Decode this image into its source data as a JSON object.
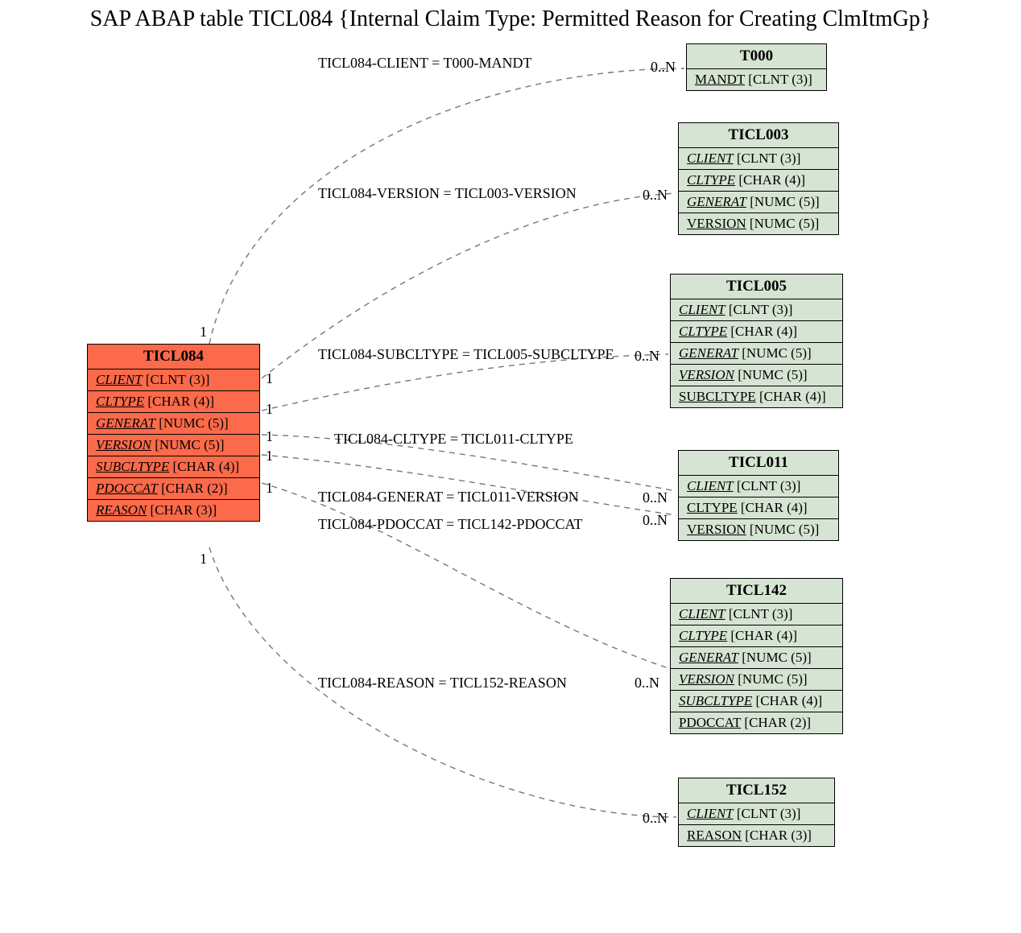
{
  "title": "SAP ABAP table TICL084 {Internal Claim Type: Permitted Reason for Creating ClmItmGp}",
  "mainEntity": {
    "name": "TICL084",
    "fields": [
      {
        "name": "CLIENT",
        "type": "[CLNT (3)]",
        "fk": true
      },
      {
        "name": "CLTYPE",
        "type": "[CHAR (4)]",
        "fk": true
      },
      {
        "name": "GENERAT",
        "type": "[NUMC (5)]",
        "fk": true
      },
      {
        "name": "VERSION",
        "type": "[NUMC (5)]",
        "fk": true
      },
      {
        "name": "SUBCLTYPE",
        "type": "[CHAR (4)]",
        "fk": true
      },
      {
        "name": "PDOCCAT",
        "type": "[CHAR (2)]",
        "fk": true
      },
      {
        "name": "REASON",
        "type": "[CHAR (3)]",
        "fk": true
      }
    ]
  },
  "relatedEntities": [
    {
      "name": "T000",
      "fields": [
        {
          "name": "MANDT",
          "type": "[CLNT (3)]",
          "pk": true
        }
      ]
    },
    {
      "name": "TICL003",
      "fields": [
        {
          "name": "CLIENT",
          "type": "[CLNT (3)]",
          "fk": true
        },
        {
          "name": "CLTYPE",
          "type": "[CHAR (4)]",
          "fk": true
        },
        {
          "name": "GENERAT",
          "type": "[NUMC (5)]",
          "fk": true
        },
        {
          "name": "VERSION",
          "type": "[NUMC (5)]",
          "pk": true
        }
      ]
    },
    {
      "name": "TICL005",
      "fields": [
        {
          "name": "CLIENT",
          "type": "[CLNT (3)]",
          "fk": true
        },
        {
          "name": "CLTYPE",
          "type": "[CHAR (4)]",
          "fk": true
        },
        {
          "name": "GENERAT",
          "type": "[NUMC (5)]",
          "fk": true
        },
        {
          "name": "VERSION",
          "type": "[NUMC (5)]",
          "fk": true
        },
        {
          "name": "SUBCLTYPE",
          "type": "[CHAR (4)]",
          "pk": true
        }
      ]
    },
    {
      "name": "TICL011",
      "fields": [
        {
          "name": "CLIENT",
          "type": "[CLNT (3)]",
          "fk": true
        },
        {
          "name": "CLTYPE",
          "type": "[CHAR (4)]",
          "pk": true
        },
        {
          "name": "VERSION",
          "type": "[NUMC (5)]",
          "pk": true
        }
      ]
    },
    {
      "name": "TICL142",
      "fields": [
        {
          "name": "CLIENT",
          "type": "[CLNT (3)]",
          "fk": true
        },
        {
          "name": "CLTYPE",
          "type": "[CHAR (4)]",
          "fk": true
        },
        {
          "name": "GENERAT",
          "type": "[NUMC (5)]",
          "fk": true
        },
        {
          "name": "VERSION",
          "type": "[NUMC (5)]",
          "fk": true
        },
        {
          "name": "SUBCLTYPE",
          "type": "[CHAR (4)]",
          "fk": true
        },
        {
          "name": "PDOCCAT",
          "type": "[CHAR (2)]",
          "pk": true
        }
      ]
    },
    {
      "name": "TICL152",
      "fields": [
        {
          "name": "CLIENT",
          "type": "[CLNT (3)]",
          "fk": true
        },
        {
          "name": "REASON",
          "type": "[CHAR (3)]",
          "pk": true
        }
      ]
    }
  ],
  "relations": [
    {
      "label": "TICL084-CLIENT = T000-MANDT",
      "left": "1",
      "right": "0..N"
    },
    {
      "label": "TICL084-VERSION = TICL003-VERSION",
      "left": "1",
      "right": "0..N"
    },
    {
      "label": "TICL084-SUBCLTYPE = TICL005-SUBCLTYPE",
      "left": "1",
      "right": "0..N"
    },
    {
      "label": "TICL084-CLTYPE = TICL011-CLTYPE",
      "left": "1",
      "right": "0..N"
    },
    {
      "label": "TICL084-GENERAT = TICL011-VERSION",
      "left": "1",
      "right": "0..N"
    },
    {
      "label": "TICL084-PDOCCAT = TICL142-PDOCCAT",
      "left": "1",
      "right": "0..N"
    },
    {
      "label": "TICL084-REASON = TICL152-REASON",
      "left": "1",
      "right": "0..N"
    }
  ]
}
